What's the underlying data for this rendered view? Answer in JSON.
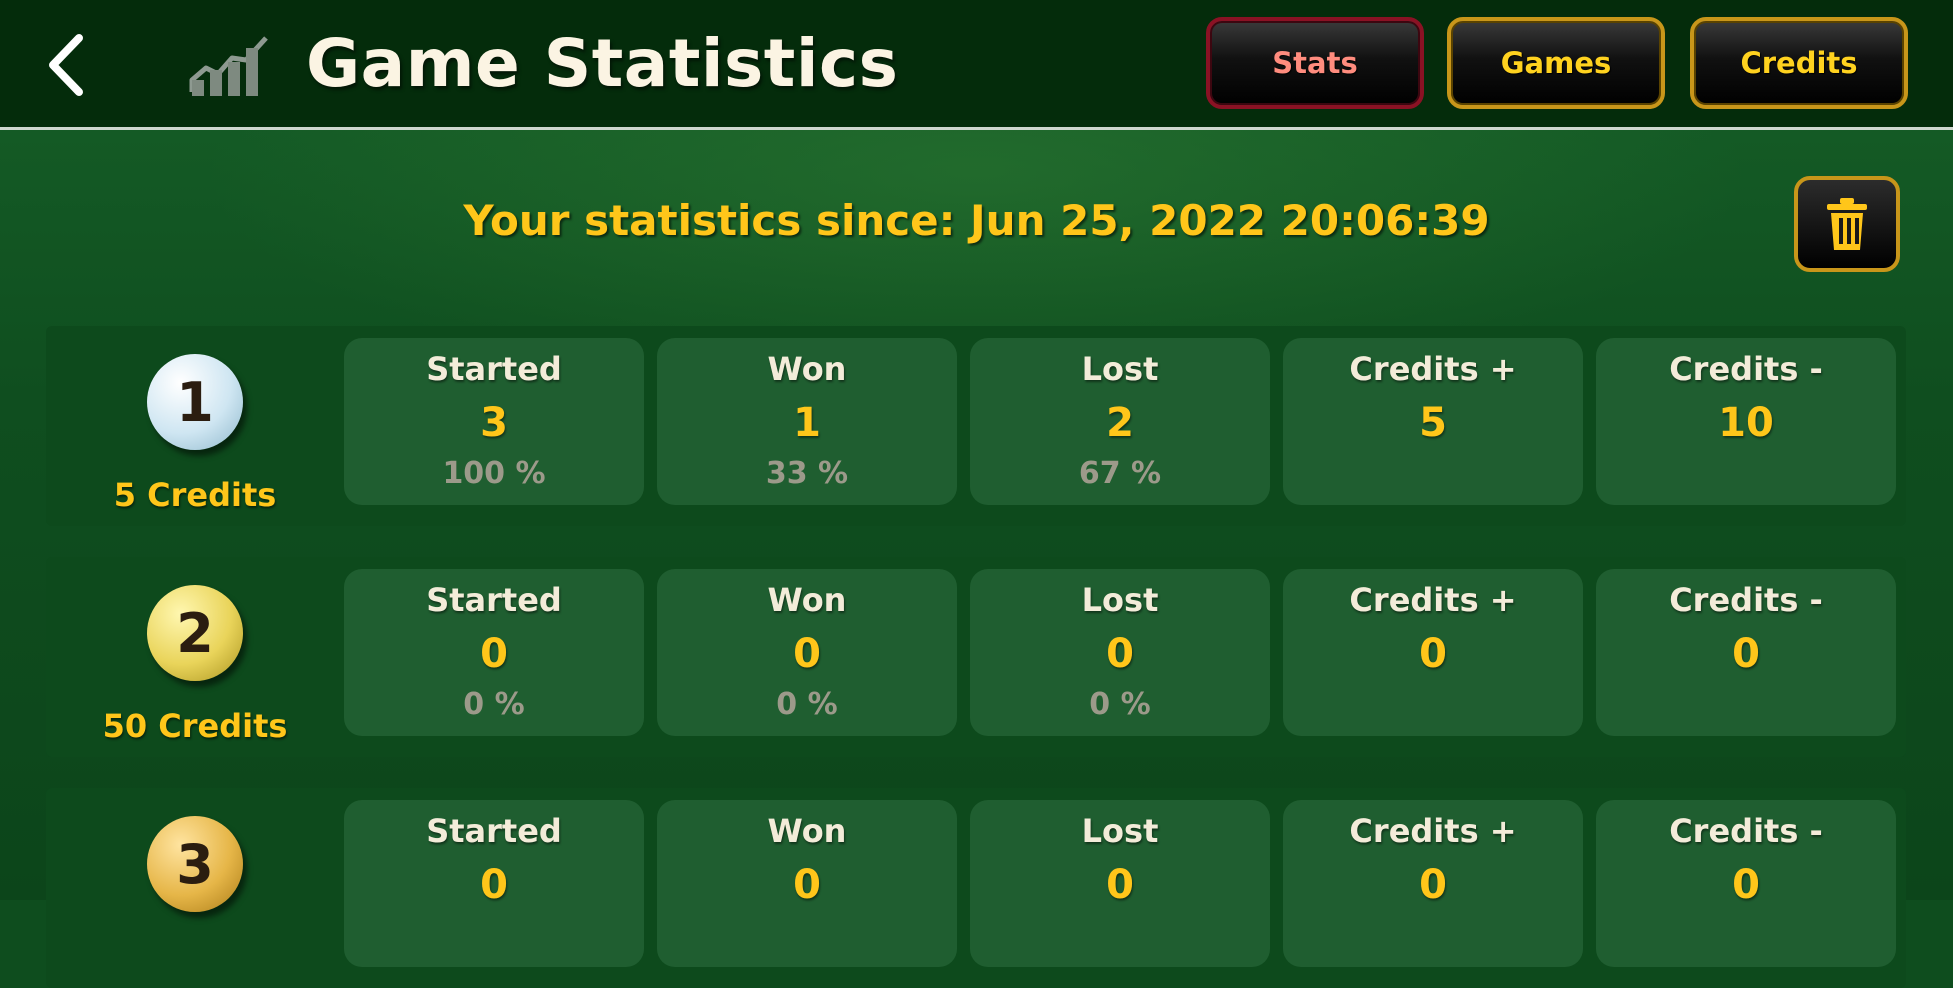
{
  "header": {
    "title": "Game Statistics",
    "tabs": [
      "Stats",
      "Games",
      "Credits"
    ],
    "active_tab": "Stats",
    "icons": {
      "back": "chevron-left-icon",
      "chart": "chart-icon",
      "trash": "trash-icon"
    }
  },
  "since_text": "Your statistics since: Jun 25, 2022 20:06:39",
  "stat_labels": [
    "Started",
    "Won",
    "Lost",
    "Credits +",
    "Credits -"
  ],
  "rows": [
    {
      "number": "1",
      "credits": "5 Credits",
      "values": [
        "3",
        "1",
        "2",
        "5",
        "10"
      ],
      "percents": [
        "100 %",
        "33 %",
        "67 %"
      ]
    },
    {
      "number": "2",
      "credits": "50 Credits",
      "values": [
        "0",
        "0",
        "0",
        "0",
        "0"
      ],
      "percents": [
        "0 %",
        "0 %",
        "0 %"
      ]
    },
    {
      "number": "3",
      "credits": "",
      "values": [
        "0",
        "0",
        "0",
        "0",
        "0"
      ],
      "percents": [
        "",
        "",
        ""
      ]
    }
  ],
  "colors": {
    "accent": "#ffc61a",
    "header_bg": "#042c0b",
    "panel_bg": "#0e4d1e",
    "cell_bg": "#1f5e30",
    "active_tab_text": "#ff8c7e",
    "tab_border": "#c8961a"
  }
}
